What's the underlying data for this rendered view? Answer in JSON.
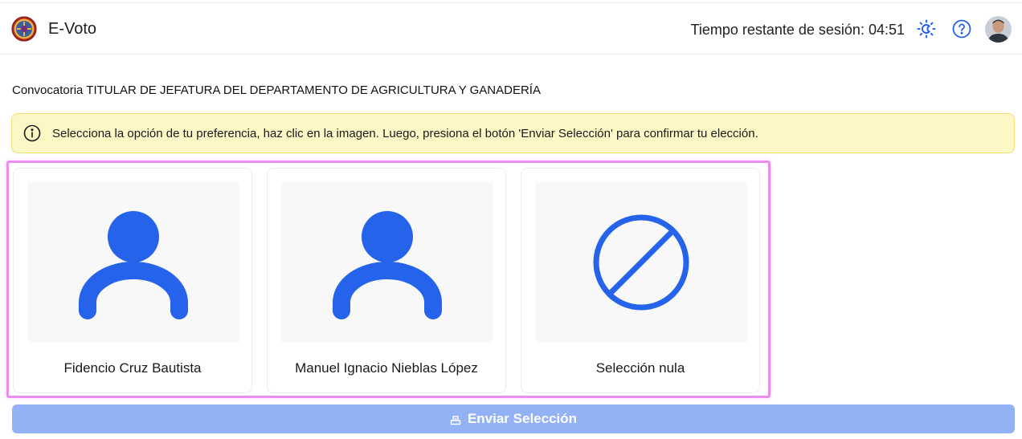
{
  "app": {
    "title": "E-Voto"
  },
  "header": {
    "session_text": "Tiempo restante de sesión: 04:51",
    "icons": [
      "theme-toggle-icon",
      "help-icon",
      "user-avatar"
    ]
  },
  "convocatoria": "Convocatoria TITULAR DE JEFATURA DEL DEPARTAMENTO DE AGRICULTURA Y GANADERÍA",
  "alert": {
    "icon": "info-icon",
    "text": "Selecciona la opción de tu preferencia, haz clic en la imagen. Luego, presiona el botón 'Enviar Selección' para confirmar tu elección."
  },
  "options": [
    {
      "label": "Fidencio Cruz Bautista",
      "icon": "person-icon"
    },
    {
      "label": "Manuel Ignacio Nieblas López",
      "icon": "person-icon"
    },
    {
      "label": "Selección nula",
      "icon": "null-vote-icon"
    }
  ],
  "submit": {
    "label": "Enviar Selección",
    "icon": "ballot-box-icon",
    "disabled": true
  },
  "colors": {
    "accent": "#2563eb",
    "alert_bg": "#fdf7c6",
    "alert_border": "#f1dc78",
    "selection_border": "#ec8ef0",
    "submit_disabled_bg": "#93b2f5"
  }
}
